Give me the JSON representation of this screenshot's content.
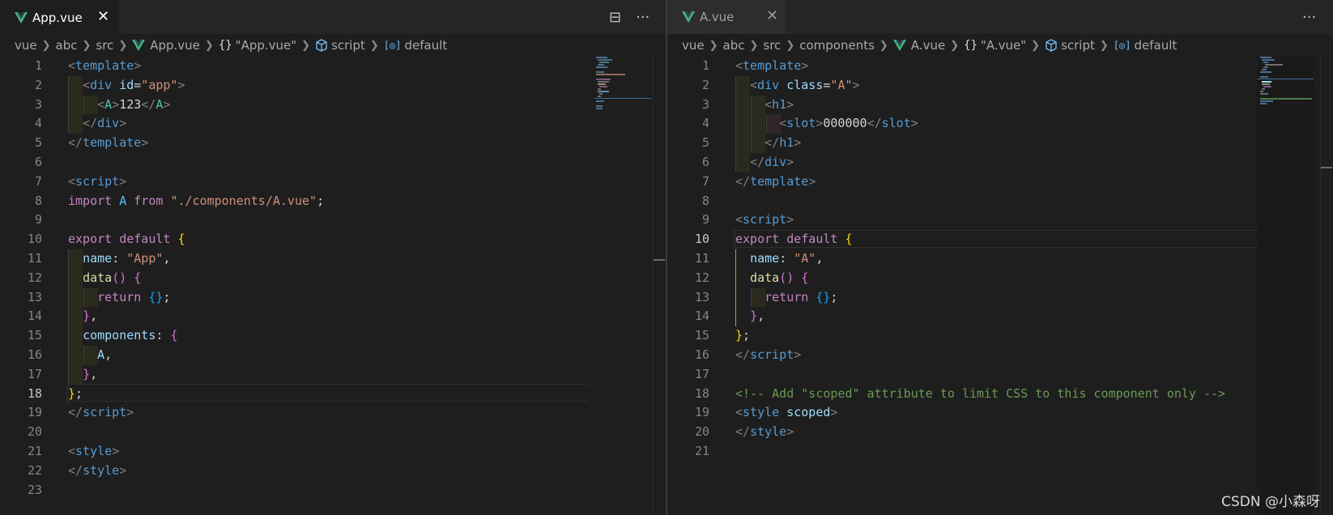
{
  "left": {
    "tab": {
      "label": "App.vue",
      "close": "✕"
    },
    "actions": {
      "split": "⊟",
      "more": "···"
    },
    "breadcrumb": [
      "vue",
      "abc",
      "src",
      "App.vue",
      "\"App.vue\"",
      "script",
      "default"
    ],
    "lines": [
      "1",
      "2",
      "3",
      "4",
      "5",
      "6",
      "7",
      "8",
      "9",
      "10",
      "11",
      "12",
      "13",
      "14",
      "15",
      "16",
      "17",
      "18",
      "19",
      "20",
      "21",
      "22",
      "23"
    ],
    "current_line": "18"
  },
  "right": {
    "tab": {
      "label": "A.vue",
      "close": "✕"
    },
    "actions": {
      "more": "···"
    },
    "breadcrumb": [
      "vue",
      "abc",
      "src",
      "components",
      "A.vue",
      "\"A.vue\"",
      "script",
      "default"
    ],
    "lines": [
      "1",
      "2",
      "3",
      "4",
      "5",
      "6",
      "7",
      "8",
      "9",
      "10",
      "11",
      "12",
      "13",
      "14",
      "15",
      "16",
      "17",
      "18",
      "19",
      "20",
      "21"
    ],
    "current_line": "10"
  },
  "code": {
    "template_tag": "template",
    "div_tag": "div",
    "id_attr": "id",
    "app_val": "\"app\"",
    "A_tag": "A",
    "content_123": "123",
    "script_tag": "script",
    "import_kw": "import",
    "A_ident": "A",
    "from_kw": "from",
    "import_path": "\"./components/A.vue\"",
    "export_kw": "export",
    "default_kw": "default",
    "name_key": "name",
    "app_name": "\"App\"",
    "data_fn": "data",
    "return_kw": "return",
    "components_key": "components",
    "style_tag": "style",
    "class_attr": "class",
    "A_class_val": "\"A\"",
    "h1_tag": "h1",
    "slot_tag": "slot",
    "slot_content": "000000",
    "a_name": "\"A\"",
    "comment": "<!-- Add \"scoped\" attribute to limit CSS to this component only -->",
    "scoped_attr": "scoped"
  },
  "watermark": "CSDN @小森呀",
  "colors": {
    "background": "#1e1e1e",
    "tabbar": "#252526",
    "keyword": "#c586c0",
    "string": "#ce9178",
    "tag": "#569cd6",
    "component": "#4ec9b0",
    "comment": "#6a9955"
  }
}
